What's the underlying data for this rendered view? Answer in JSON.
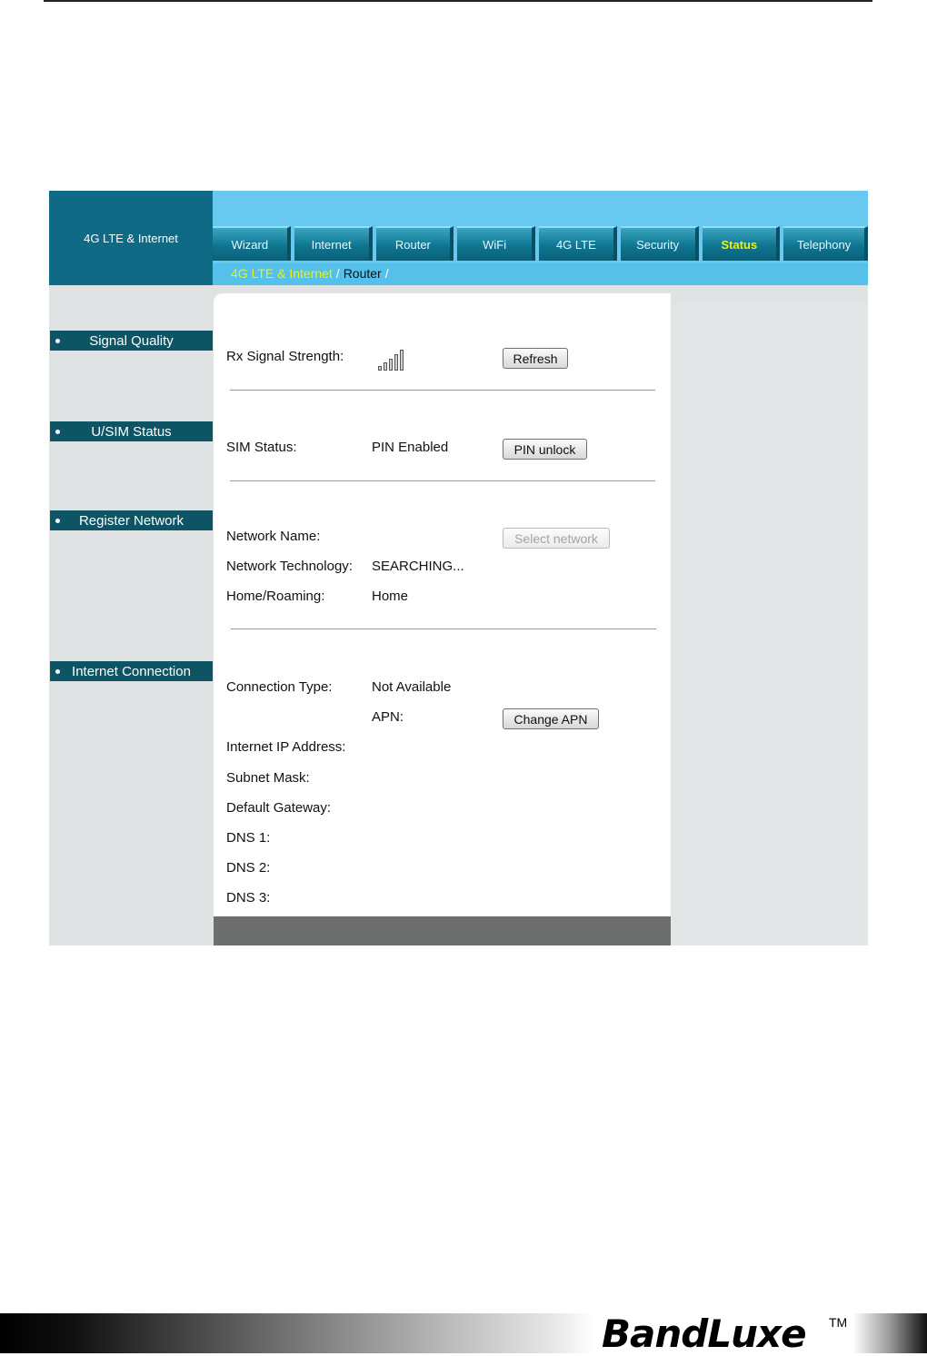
{
  "brand": {
    "label": "4G LTE & Internet"
  },
  "tabs": [
    {
      "label": "Wizard"
    },
    {
      "label": "Internet"
    },
    {
      "label": "Router"
    },
    {
      "label": "WiFi"
    },
    {
      "label": "4G LTE"
    },
    {
      "label": "Security"
    },
    {
      "label": "Status",
      "active": true
    },
    {
      "label": "Telephony"
    }
  ],
  "breadcrumb": {
    "current": "4G LTE & Internet",
    "sep1": "/",
    "link": "Router",
    "sep2": "/"
  },
  "sidebar": {
    "items": [
      {
        "label": "Signal Quality"
      },
      {
        "label": "U/SIM Status"
      },
      {
        "label": "Register Network"
      },
      {
        "label": "Internet Connection"
      }
    ]
  },
  "signal": {
    "label": "Rx Signal Strength:",
    "icon": "signal-bars-icon",
    "refresh_label": "Refresh"
  },
  "sim": {
    "label": "SIM Status:",
    "value": "PIN Enabled",
    "unlock_label": "PIN unlock"
  },
  "network": {
    "name_label": "Network Name:",
    "select_label": "Select network",
    "tech_label": "Network Technology:",
    "tech_value": "SEARCHING...",
    "roaming_label": "Home/Roaming:",
    "roaming_value": "Home"
  },
  "internet": {
    "type_label": "Connection Type:",
    "type_value": "Not Available",
    "apn_label": "APN:",
    "change_apn_label": "Change APN",
    "ip_label": "Internet IP Address:",
    "mask_label": "Subnet Mask:",
    "gateway_label": "Default Gateway:",
    "dns1_label": "DNS 1:",
    "dns2_label": "DNS 2:",
    "dns3_label": "DNS 3:"
  },
  "footer": {
    "logo": "BandLuxe",
    "tm": "TM"
  }
}
